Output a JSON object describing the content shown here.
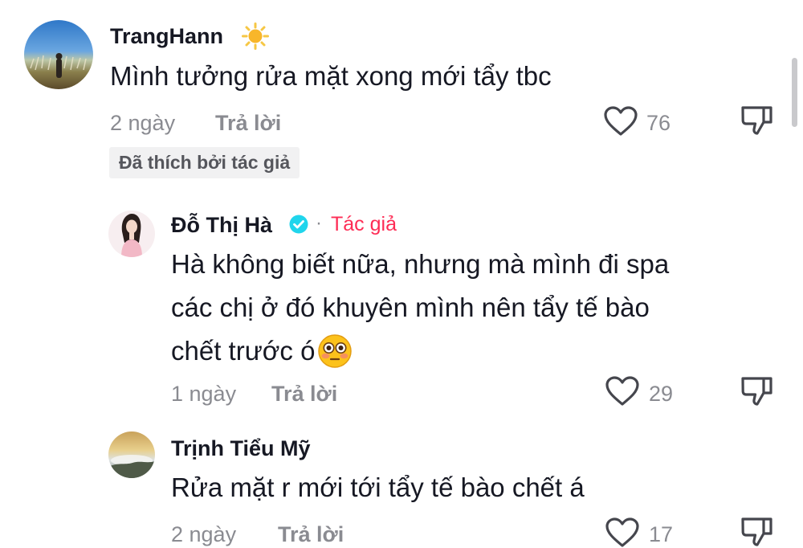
{
  "comments": [
    {
      "username": "TrangHann",
      "name_emoji": "sun",
      "text": "Mình tưởng rửa mặt xong mới tẩy tbc",
      "time": "2 ngày",
      "reply_label": "Trả lời",
      "likes": "76",
      "liked_by_author": "Đã thích bởi tác giả"
    },
    {
      "username": "Đỗ Thị Hà",
      "verified": true,
      "separator": "·",
      "author_label": "Tác giả",
      "text_lines": [
        "Hà không biết nữa, nhưng mà mình đi spa",
        "các chị ở đó khuyên mình nên tẩy tế bào",
        "chết trước ó"
      ],
      "text_emoji": "flushed-face",
      "time": "1 ngày",
      "reply_label": "Trả lời",
      "likes": "29"
    },
    {
      "username": "Trịnh Tiểu Mỹ",
      "text": "Rửa mặt r mới tới tẩy tế bào chết á",
      "time": "2 ngày",
      "reply_label": "Trả lời",
      "likes": "17"
    }
  ],
  "icons": {
    "like": "heart-outline-icon",
    "dislike": "thumbs-down-icon",
    "verified": "verified-badge-icon"
  },
  "colors": {
    "author_accent": "#fe2c55",
    "verified": "#20d5ec",
    "muted": "#8a8b91"
  }
}
